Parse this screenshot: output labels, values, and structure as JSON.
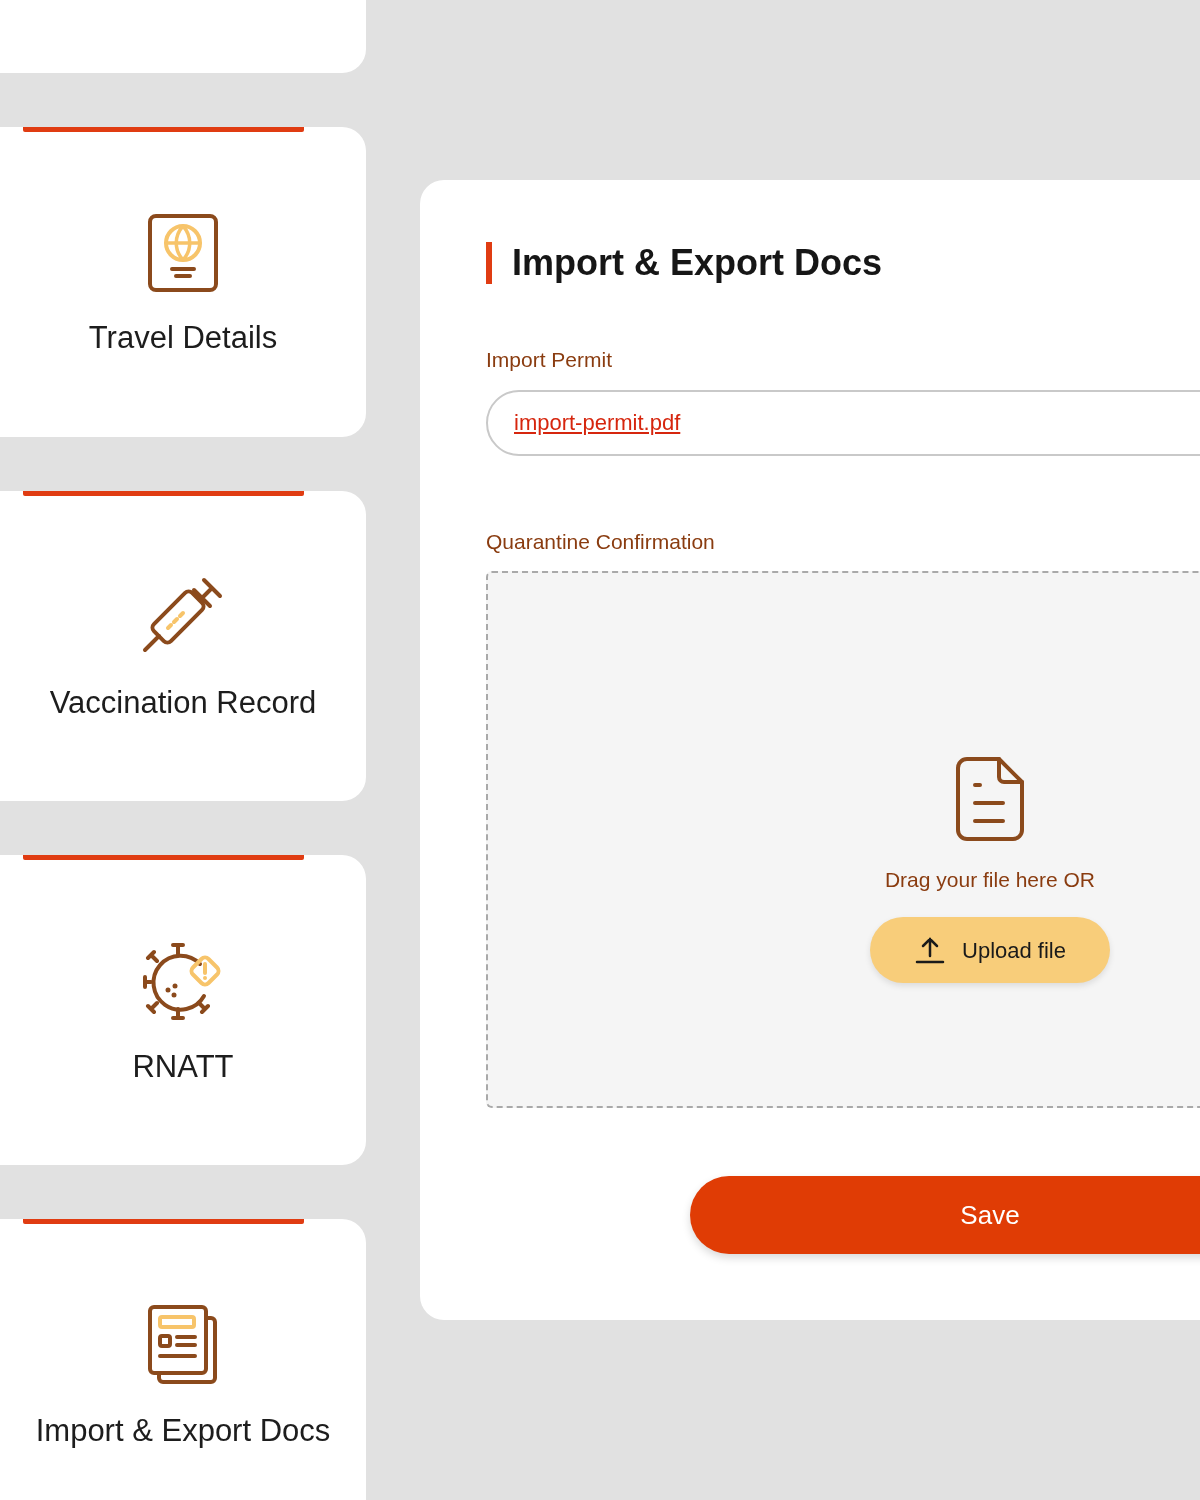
{
  "sidebar": {
    "cards": [
      {
        "kind": "passport",
        "label": "Travel Details"
      },
      {
        "kind": "syringe",
        "label": "Vaccination Record"
      },
      {
        "kind": "virus-alert",
        "label": "RNATT"
      },
      {
        "kind": "documents",
        "label": "Import & Export Docs"
      }
    ]
  },
  "panel": {
    "title": "Import & Export Docs",
    "fields": [
      {
        "kind": "file",
        "label": "Import Permit",
        "value": "import-permit.pdf"
      },
      {
        "kind": "dropzone",
        "label": "Quarantine Confirmation",
        "prompt": "Drag your file here OR",
        "button": "Upload file"
      }
    ],
    "save_button": "Save"
  }
}
